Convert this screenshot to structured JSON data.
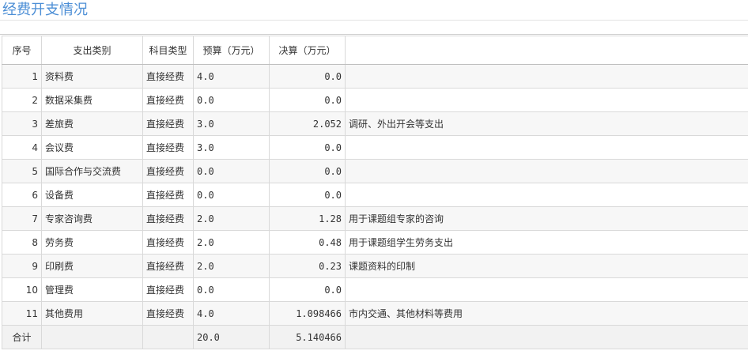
{
  "title": "经费开支情况",
  "table": {
    "headers": [
      "序号",
      "支出类别",
      "科目类型",
      "预算（万元）",
      "决算（万元）",
      ""
    ],
    "rows": [
      {
        "index": "1",
        "category": "资料费",
        "type": "直接经费",
        "budget": "4.0",
        "final": "0.0",
        "note": ""
      },
      {
        "index": "2",
        "category": "数据采集费",
        "type": "直接经费",
        "budget": "0.0",
        "final": "0.0",
        "note": ""
      },
      {
        "index": "3",
        "category": "差旅费",
        "type": "直接经费",
        "budget": "3.0",
        "final": "2.052",
        "note": "调研、外出开会等支出"
      },
      {
        "index": "4",
        "category": "会议费",
        "type": "直接经费",
        "budget": "3.0",
        "final": "0.0",
        "note": ""
      },
      {
        "index": "5",
        "category": "国际合作与交流费",
        "type": "直接经费",
        "budget": "0.0",
        "final": "0.0",
        "note": ""
      },
      {
        "index": "6",
        "category": "设备费",
        "type": "直接经费",
        "budget": "0.0",
        "final": "0.0",
        "note": ""
      },
      {
        "index": "7",
        "category": "专家咨询费",
        "type": "直接经费",
        "budget": "2.0",
        "final": "1.28",
        "note": "用于课题组专家的咨询"
      },
      {
        "index": "8",
        "category": "劳务费",
        "type": "直接经费",
        "budget": "2.0",
        "final": "0.48",
        "note": "用于课题组学生劳务支出"
      },
      {
        "index": "9",
        "category": "印刷费",
        "type": "直接经费",
        "budget": "2.0",
        "final": "0.23",
        "note": "课题资料的印制"
      },
      {
        "index": "10",
        "category": "管理费",
        "type": "直接经费",
        "budget": "0.0",
        "final": "0.0",
        "note": ""
      },
      {
        "index": "11",
        "category": "其他费用",
        "type": "直接经费",
        "budget": "4.0",
        "final": "1.098466",
        "note": "市内交通、其他材料等费用"
      }
    ],
    "total": {
      "label": "合计",
      "budget": "20.0",
      "final": "5.140466"
    }
  }
}
